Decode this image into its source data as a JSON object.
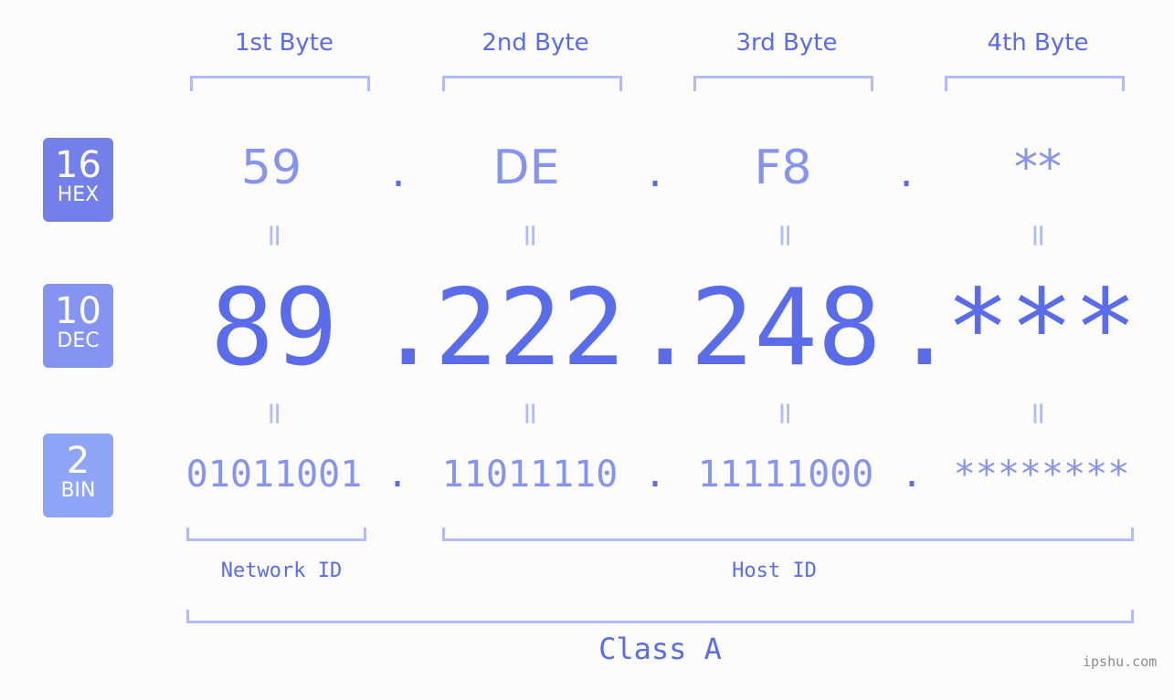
{
  "headers": [
    "1st Byte",
    "2nd Byte",
    "3rd Byte",
    "4th Byte"
  ],
  "badges": [
    {
      "num": "16",
      "label": "HEX",
      "color": "#7480ea"
    },
    {
      "num": "10",
      "label": "DEC",
      "color": "#8594f1"
    },
    {
      "num": "2",
      "label": "BIN",
      "color": "#8fa5f7"
    }
  ],
  "hex": [
    "59",
    "DE",
    "F8",
    "**"
  ],
  "dec": [
    "89",
    "222",
    "248",
    "***"
  ],
  "bin": [
    "01011001",
    "11011110",
    "11111000",
    "********"
  ],
  "separator": ".",
  "equals": "=",
  "network_label": "Network ID",
  "host_label": "Host ID",
  "class_label": "Class A",
  "watermark": "ipshu.com"
}
